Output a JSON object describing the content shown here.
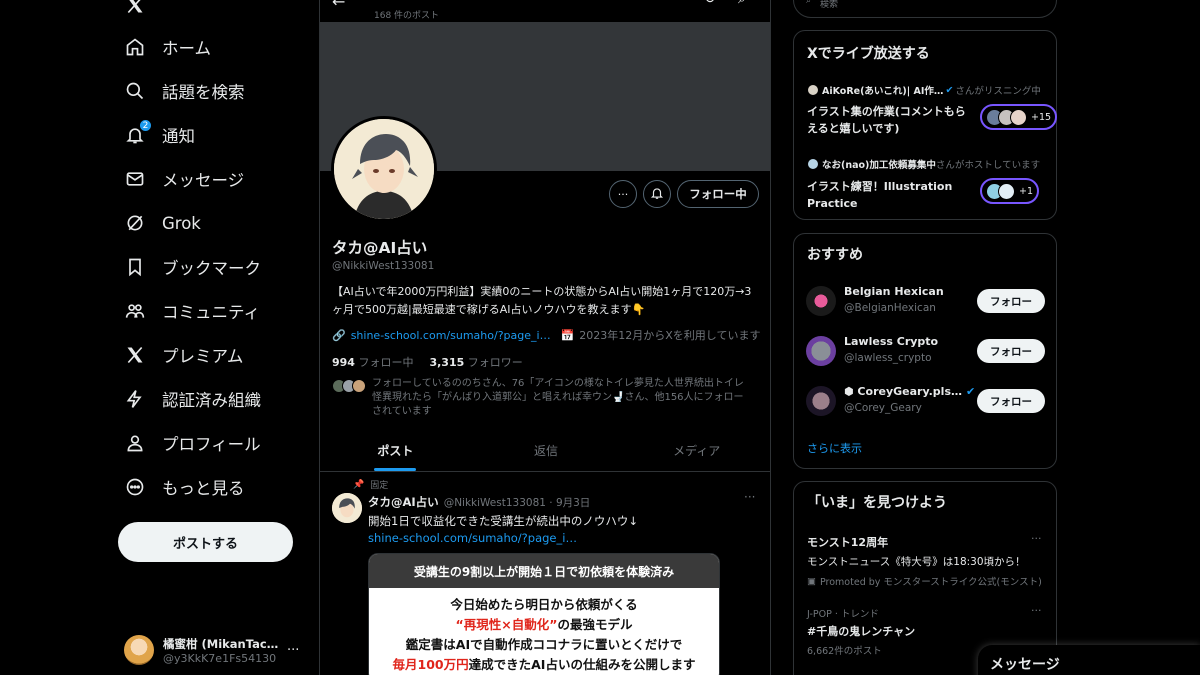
{
  "nav": {
    "logo": "X",
    "items": [
      {
        "label": "ホーム",
        "icon": "home-icon"
      },
      {
        "label": "話題を検索",
        "icon": "search-icon"
      },
      {
        "label": "通知",
        "icon": "bell-icon",
        "badge": "2"
      },
      {
        "label": "メッセージ",
        "icon": "mail-icon"
      },
      {
        "label": "Grok",
        "icon": "grok-icon"
      },
      {
        "label": "ブックマーク",
        "icon": "bookmark-icon"
      },
      {
        "label": "コミュニティ",
        "icon": "communities-icon"
      },
      {
        "label": "プレミアム",
        "icon": "x-premium-icon"
      },
      {
        "label": "認証済み組織",
        "icon": "lightning-icon"
      },
      {
        "label": "プロフィール",
        "icon": "person-icon"
      },
      {
        "label": "もっと見る",
        "icon": "more-circle-icon"
      }
    ],
    "post_button": "ポストする",
    "account": {
      "name": "橘蜜柑 (MikanTachi…",
      "handle": "@y3KkK7e1Fs54130",
      "more": "···"
    }
  },
  "profile": {
    "posts_count": "168 件のポスト",
    "name": "タカ@AI占い",
    "handle": "@NikkiWest133081",
    "bio": "【AI占いで年2000万円利益】実績0のニートの状態からAI占い開始1ヶ月で120万→3ヶ月で500万越|最短最速で稼げるAI占いノウハウを教えます👇",
    "link": "shine-school.com/sumaho/?page_i…",
    "joined": "2023年12月からXを利用しています",
    "following_count": "994",
    "following_label": "フォロー中",
    "followers_count": "3,315",
    "followers_label": "フォロワー",
    "followed_by": "フォローしているののちさん、76「アイコンの様なトイレ夢見た人世界続出トイレ怪異現れたら「がんばり入道郭公」と唱えれば幸ウン🚽さん、他156人にフォローされています",
    "follow_state": "フォロー中",
    "more": "···"
  },
  "tabs": [
    {
      "label": "ポスト",
      "active": true
    },
    {
      "label": "返信",
      "active": false
    },
    {
      "label": "メディア",
      "active": false
    }
  ],
  "tweet": {
    "pinned": "固定",
    "name": "タカ@AI占い",
    "handle_date": "@NikkiWest133081 · 9月3日",
    "text": "開始1日で収益化できた受講生が続出中のノウハウ↓",
    "link": "shine-school.com/sumaho/?page_i…",
    "more": "···",
    "image": {
      "header": "受講生の9割以上が開始１日で初依頼を体験済み",
      "line1": "今日始めたら明日から依頼がくる",
      "line2_red": "“再現性×自動化”",
      "line2_rest": "の最強モデル",
      "line3": "鑑定書はAIで自動作成ココナラに置いとくだけで",
      "line4_red": "毎月100万円",
      "line4_rest": "達成できたAI占いの仕組みを公開します"
    }
  },
  "right": {
    "search_placeholder": "検索",
    "live": {
      "title": "Xでライブ放送する",
      "items": [
        {
          "host": "AiKoRe(あいこれ)| AI作…",
          "host_suffix": "さんがリスニング中",
          "title": "イラスト集の作業(コメントもらえると嬉しいです)",
          "count": "+15"
        },
        {
          "host": "なお(nao)加工依頼募集中",
          "host_suffix": "さんがホストしています",
          "title": "イラスト練習！Illustration Practice",
          "count": "+1"
        }
      ]
    },
    "suggest": {
      "title": "おすすめ",
      "items": [
        {
          "name": "Belgian Hexican",
          "handle": "@BelgianHexican",
          "button": "フォロー"
        },
        {
          "name": "Lawless Crypto",
          "handle": "@lawless_crypto",
          "button": "フォロー"
        },
        {
          "name": "⬢ CoreyGeary.pls…",
          "handle": "@Corey_Geary",
          "button": "フォロー"
        }
      ],
      "show_more": "さらに表示"
    },
    "trends": {
      "title": "「いま」を見つけよう",
      "items": [
        {
          "name": "モンスト12周年",
          "sub": "モンストニュース《特大号》は18:30頃から！",
          "meta": "Promoted by モンスターストライク公式(モンスト)",
          "more": "···"
        },
        {
          "cat": "J-POP · トレンド",
          "name": "#千鳥の鬼レンチャン",
          "meta": "6,662件のポスト",
          "more": "···"
        }
      ]
    }
  },
  "messages_drawer": "メッセージ",
  "colors": {
    "accent": "#1d9bf0",
    "border": "#2f3336",
    "muted": "#71767b",
    "live": "#7856ff"
  }
}
